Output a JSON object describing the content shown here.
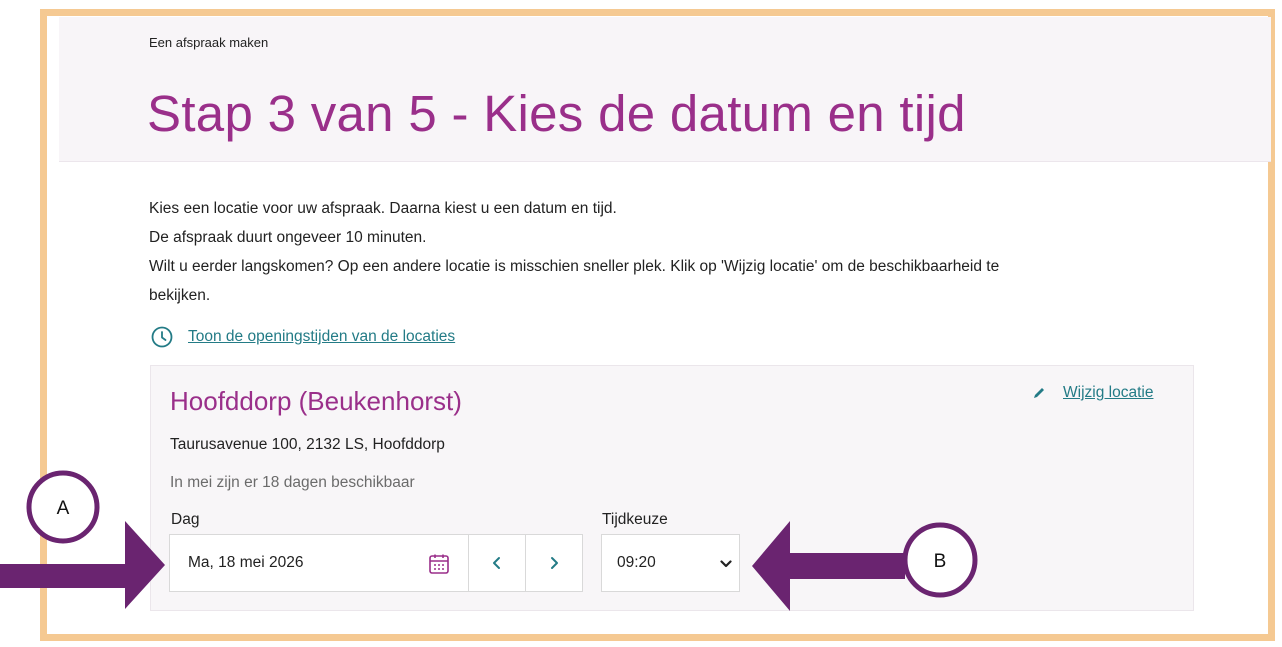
{
  "breadcrumb": "Een afspraak maken",
  "page_title": "Stap 3 van 5 - Kies de datum en tijd",
  "intro": {
    "line1": "Kies een locatie voor uw afspraak. Daarna kiest u een datum en tijd.",
    "line2": "De afspraak duurt ongeveer 10 minuten.",
    "line3": "Wilt u eerder langskomen? Op een andere locatie is misschien sneller plek. Klik op 'Wijzig locatie' om de beschikbaarheid te",
    "line4": "bekijken."
  },
  "opening_hours_link": {
    "label": "Toon de openingstijden van de locaties",
    "icon": "clock-icon"
  },
  "location": {
    "name": "Hoofddorp (Beukenhorst)",
    "address": "Taurusavenue 100, 2132 LS, Hoofddorp",
    "availability": "In mei zijn er 18 dagen beschikbaar",
    "change_label": "Wijzig locatie",
    "change_icon": "pencil-icon"
  },
  "date_picker": {
    "label": "Dag",
    "value": "Ma, 18 mei 2026",
    "calendar_icon": "calendar-icon",
    "prev_icon": "chevron-left-icon",
    "next_icon": "chevron-right-icon"
  },
  "time_picker": {
    "label": "Tijdkeuze",
    "value": "09:20",
    "icon": "chevron-down-icon"
  },
  "annotations": {
    "marker_a": "A",
    "marker_b": "B"
  },
  "colors": {
    "frame": "#f5c992",
    "title": "#9a2f8a",
    "link": "#237b86",
    "arrow": "#6a2470",
    "header_background": "#f8f5f8",
    "panel_background": "#f8f6f8"
  }
}
